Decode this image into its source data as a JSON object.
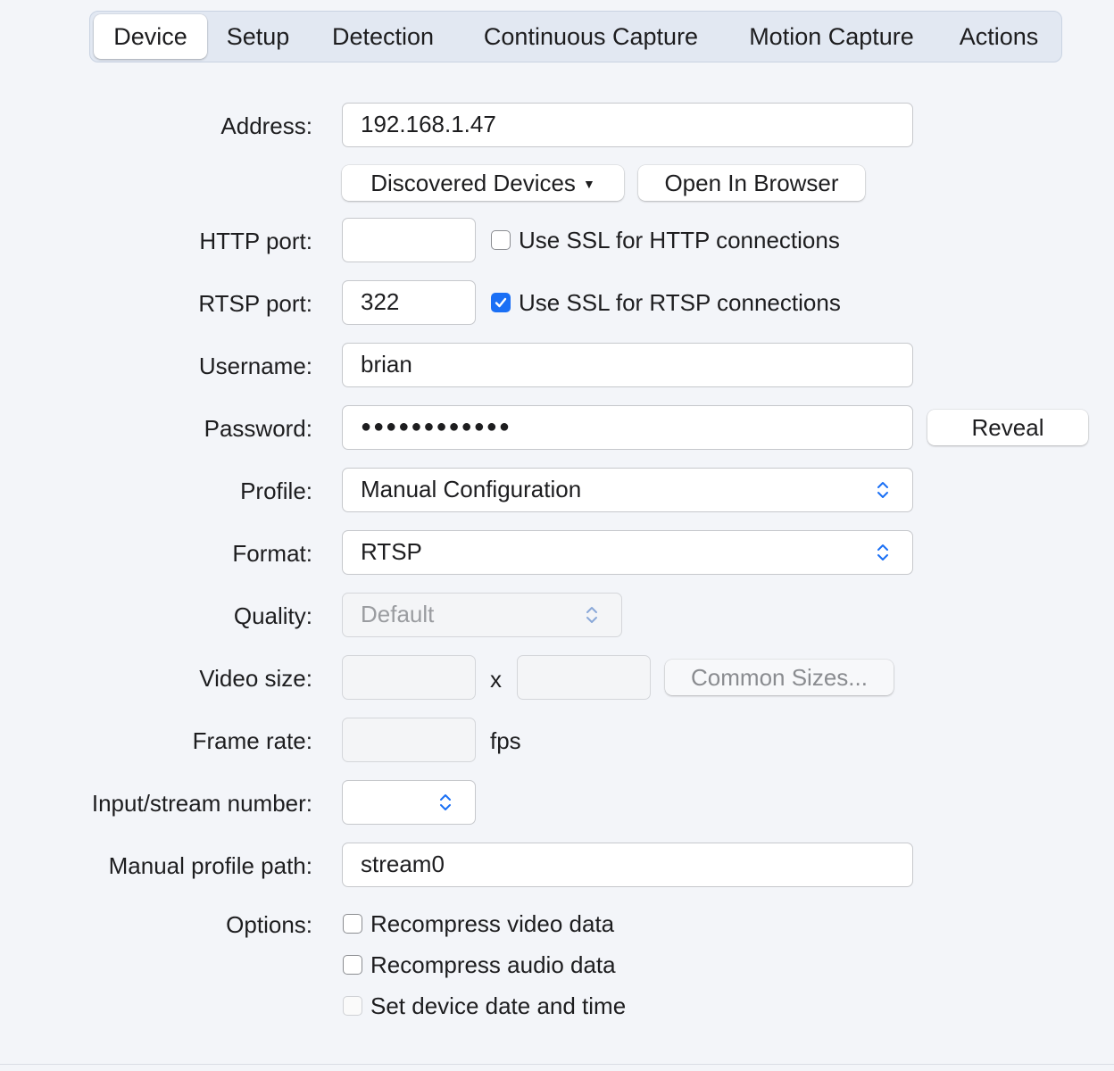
{
  "tabs": [
    {
      "label": "Device",
      "active": true
    },
    {
      "label": "Setup"
    },
    {
      "label": "Detection"
    },
    {
      "label": "Continuous Capture"
    },
    {
      "label": "Motion Capture"
    },
    {
      "label": "Actions"
    }
  ],
  "address": {
    "label": "Address:",
    "value": "192.168.1.47"
  },
  "buttons": {
    "discovered": "Discovered Devices",
    "open_browser": "Open In Browser",
    "reveal": "Reveal",
    "common_sizes": "Common Sizes..."
  },
  "http": {
    "label": "HTTP port:",
    "value": "",
    "ssl_label": "Use SSL for HTTP connections",
    "ssl_checked": false
  },
  "rtsp": {
    "label": "RTSP port:",
    "value": "322",
    "ssl_label": "Use SSL for RTSP connections",
    "ssl_checked": true
  },
  "username": {
    "label": "Username:",
    "value": "brian"
  },
  "password": {
    "label": "Password:",
    "masked": "●●●●●●●●●●●●"
  },
  "profile": {
    "label": "Profile:",
    "value": "Manual Configuration"
  },
  "format": {
    "label": "Format:",
    "value": "RTSP"
  },
  "quality": {
    "label": "Quality:",
    "value": "Default"
  },
  "video_size": {
    "label": "Video size:",
    "separator": "x"
  },
  "frame_rate": {
    "label": "Frame rate:",
    "unit": "fps"
  },
  "input_stream": {
    "label": "Input/stream number:",
    "value": ""
  },
  "manual_path": {
    "label": "Manual profile path:",
    "value": "stream0"
  },
  "options": {
    "label": "Options:",
    "items": [
      {
        "label": "Recompress video data",
        "checked": false
      },
      {
        "label": "Recompress audio data",
        "checked": false
      },
      {
        "label": "Set device date and time",
        "checked": false,
        "disabled": true
      }
    ]
  },
  "colors": {
    "accent": "#1a6ff5",
    "background": "#f3f5f9"
  }
}
